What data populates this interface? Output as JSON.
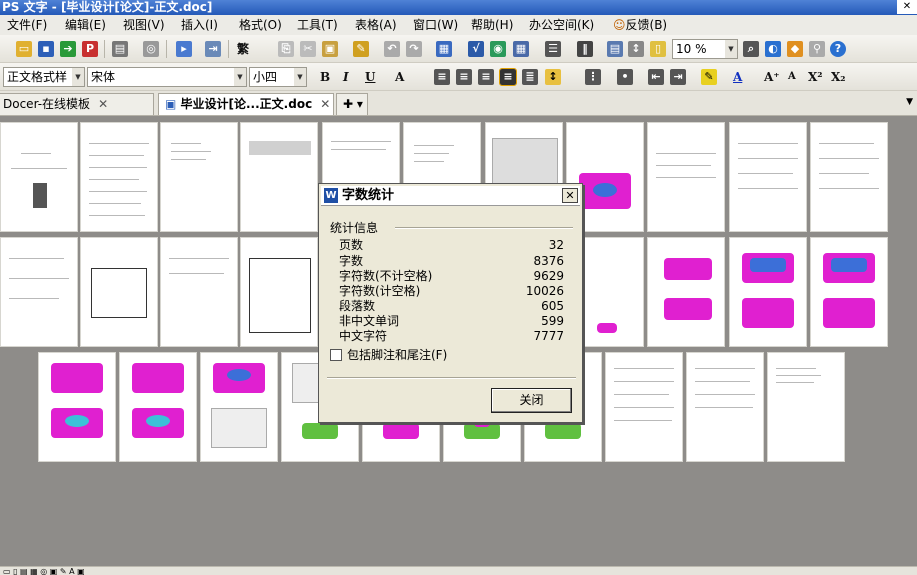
{
  "window": {
    "title": "PS 文字 - [毕业设计[论文]-正文.doc]"
  },
  "menu": [
    "文件(F)",
    "编辑(E)",
    "视图(V)",
    "插入(I)",
    "格式(O)",
    "工具(T)",
    "表格(A)",
    "窗口(W)",
    "帮助(H)",
    "办公空间(K)",
    "反馈(B)"
  ],
  "toolbar": {
    "zoom": "10 %",
    "style": "正文格式样",
    "font": "宋体",
    "size": "小四",
    "trad": "繁"
  },
  "tabs": [
    {
      "label": "Docer-在线模板",
      "active": false
    },
    {
      "label": "毕业设计[论...正文.doc",
      "active": true
    }
  ],
  "dialog": {
    "title": "字数统计",
    "section": "统计信息",
    "stats": [
      {
        "label": "页数",
        "value": "32"
      },
      {
        "label": "字数",
        "value": "8376"
      },
      {
        "label": "字符数(不计空格)",
        "value": "9629"
      },
      {
        "label": "字符数(计空格)",
        "value": "10026"
      },
      {
        "label": "段落数",
        "value": "605"
      },
      {
        "label": "非中文单词",
        "value": "599"
      },
      {
        "label": "中文字符",
        "value": "7777"
      }
    ],
    "checkbox": "包括脚注和尾注(F)",
    "close_button": "关闭"
  },
  "colors": {
    "titlebar": "#2459b8",
    "dialog_bg": "#ece9d8",
    "accent_magenta": "#e020d0",
    "accent_blue": "#3c6fd8"
  }
}
